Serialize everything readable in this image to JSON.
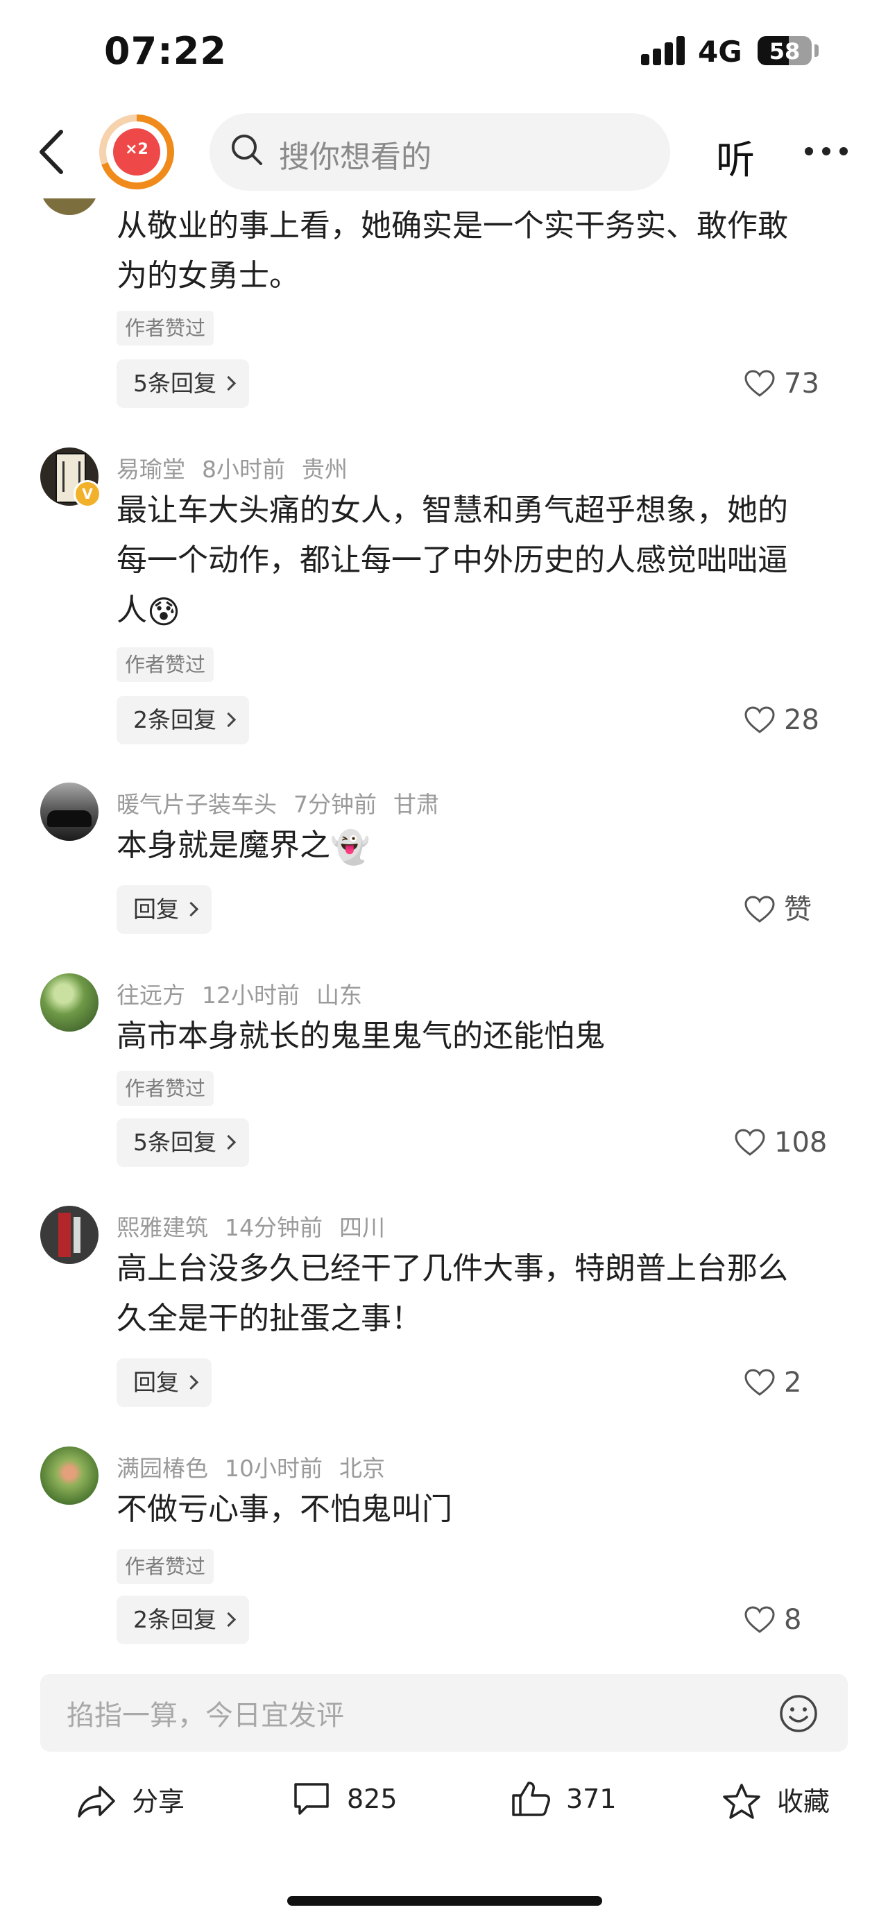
{
  "status_bar": {
    "time": "07:22",
    "network": "4G",
    "battery": "58",
    "battery_level": 0.58
  },
  "header": {
    "badge_multiplier": "×2",
    "search_placeholder": "搜你想看的",
    "listen_label": "听"
  },
  "comments": [
    {
      "author": "",
      "time": "",
      "location": "",
      "lines": [
        "从敬业的事上看，她确实是一个实干务实、敢作敢",
        "为的女勇士。"
      ],
      "author_liked": "作者赞过",
      "replies": "5条回复",
      "likes": "73"
    },
    {
      "author": "易瑜堂",
      "time": "8小时前",
      "location": "贵州",
      "lines": [
        "最让车大头痛的女人，智慧和勇气超乎想象，她的",
        "每一个动作，都让每一了中外历史的人感觉咄咄逼",
        "人"
      ],
      "emoji": "😰",
      "verified_badge": "V",
      "author_liked": "作者赞过",
      "replies": "2条回复",
      "likes": "28"
    },
    {
      "author": "暖气片子装车头",
      "time": "7分钟前",
      "location": "甘肃",
      "lines": [
        "本身就是魔界之"
      ],
      "emoji": "👻",
      "replies": "回复",
      "likes": "赞"
    },
    {
      "author": "往远方",
      "time": "12小时前",
      "location": "山东",
      "lines": [
        "高市本身就长的鬼里鬼气的还能怕鬼"
      ],
      "author_liked": "作者赞过",
      "replies": "5条回复",
      "likes": "108"
    },
    {
      "author": "熙雅建筑",
      "time": "14分钟前",
      "location": "四川",
      "lines": [
        "高上台没多久已经干了几件大事，特朗普上台那么",
        "久全是干的扯蛋之事！"
      ],
      "replies": "回复",
      "likes": "2"
    },
    {
      "author": "满园椿色",
      "time": "10小时前",
      "location": "北京",
      "lines": [
        "不做亏心事，不怕鬼叫门"
      ],
      "author_liked": "作者赞过",
      "replies": "2条回复",
      "likes": "8"
    }
  ],
  "comment_box": {
    "placeholder": "掐指一算，今日宜发评"
  },
  "bottom_bar": {
    "share": "分享",
    "comments": "825",
    "likes": "371",
    "favorite": "收藏"
  },
  "icons": [
    "back-icon",
    "search-icon",
    "more-icon",
    "heart-icon",
    "verified-icon",
    "emoji-icon",
    "share-icon",
    "comment-icon",
    "thumbs-up-icon",
    "star-icon"
  ]
}
